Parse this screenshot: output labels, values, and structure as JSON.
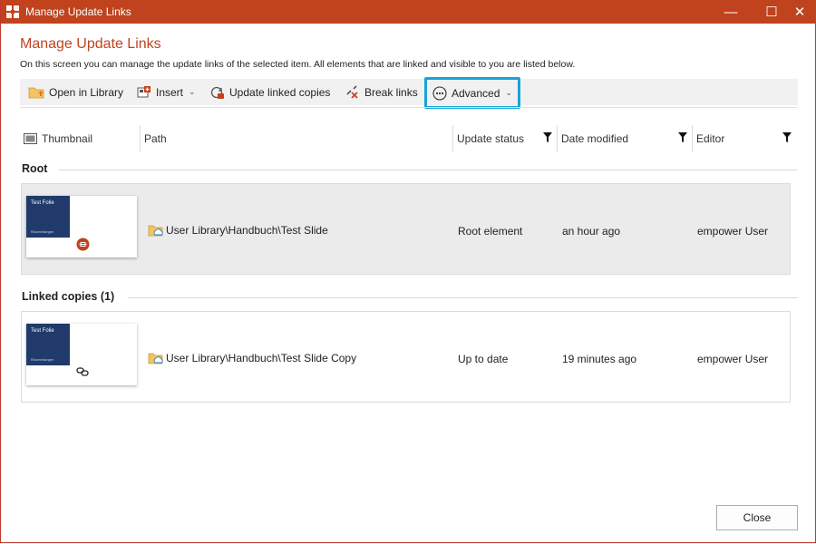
{
  "window": {
    "title": "Manage Update Links",
    "controls": {
      "minimize": "—",
      "maximize": "☐",
      "close": "✕"
    }
  },
  "header": {
    "title": "Manage Update Links",
    "description": "On this screen you can manage the update links of the selected item. All elements that are linked and visible to you are listed below."
  },
  "toolbar": {
    "open_in_library": "Open in Library",
    "insert": "Insert",
    "update_linked_copies": "Update linked copies",
    "break_links": "Break links",
    "advanced": "Advanced"
  },
  "table": {
    "columns": {
      "thumbnail": "Thumbnail",
      "path": "Path",
      "update_status": "Update status",
      "date_modified": "Date modified",
      "editor": "Editor"
    },
    "groups": [
      {
        "label": "Root",
        "rows": [
          {
            "thumb_title": "Test Folie",
            "thumb_sub": "Rückmeldungen",
            "path": "User Library\\Handbuch\\Test Slide",
            "update_status": "Root element",
            "date_modified": "an hour ago",
            "editor": "empower User",
            "badge_icon": "root-link-badge-icon"
          }
        ]
      },
      {
        "label": "Linked copies (1)",
        "rows": [
          {
            "thumb_title": "Test Folie",
            "thumb_sub": "Rückmeldungen",
            "path": "User Library\\Handbuch\\Test Slide Copy",
            "update_status": "Up to date",
            "date_modified": "19 minutes ago",
            "editor": "empower User",
            "badge_icon": "chain-link-icon"
          }
        ]
      }
    ]
  },
  "footer": {
    "close_label": "Close"
  },
  "colors": {
    "accent": "#c0431e",
    "highlight_border": "#1aa3d6",
    "thumbnail_blue": "#1f3a6b",
    "selected_row_bg": "#ebebeb"
  }
}
